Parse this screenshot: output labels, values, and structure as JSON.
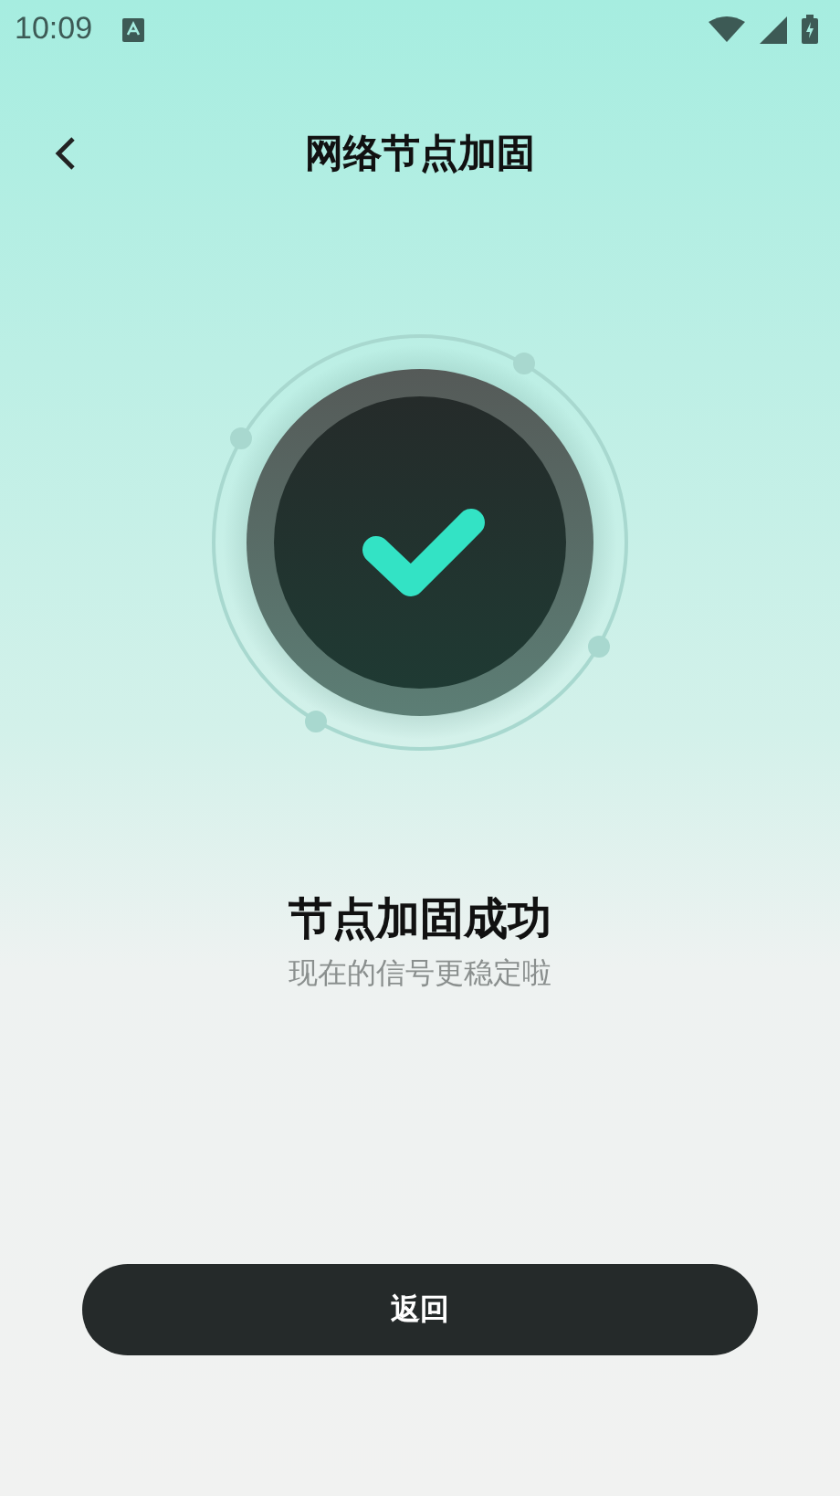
{
  "status_bar": {
    "time": "10:09"
  },
  "header": {
    "title": "网络节点加固"
  },
  "result": {
    "title": "节点加固成功",
    "subtitle": "现在的信号更稳定啦"
  },
  "button": {
    "label": "返回"
  }
}
